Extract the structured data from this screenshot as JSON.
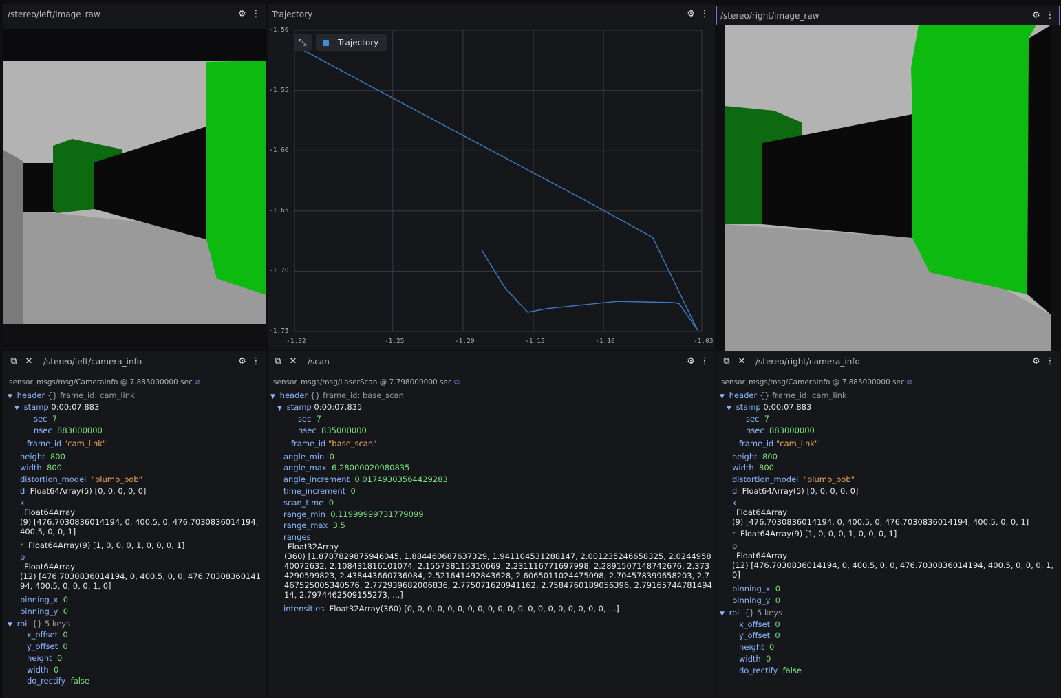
{
  "panels": {
    "left_image": {
      "title": "/stereo/left/image_raw"
    },
    "trajectory": {
      "title": "Trajectory",
      "legend": "Trajectory"
    },
    "right_image": {
      "title": "/stereo/right/image_raw"
    },
    "left_info": {
      "title": "/stereo/left/camera_info",
      "meta": "sensor_msgs/msg/CameraInfo @ 7.885000000 sec"
    },
    "scan": {
      "title": "/scan",
      "meta": "sensor_msgs/msg/LaserScan @ 7.798000000 sec"
    },
    "right_info": {
      "title": "/stereo/right/camera_info",
      "meta": "sensor_msgs/msg/CameraInfo @ 7.885000000 sec"
    }
  },
  "camera_info": {
    "header": "header",
    "header_sum": "{} frame_id: cam_link",
    "stamp": "stamp",
    "stamp_val": "0:00:07.883",
    "sec": "sec",
    "sec_val": "7",
    "nsec": "nsec",
    "nsec_val": "883000000",
    "frame_id": "frame_id",
    "frame_id_val": "\"cam_link\"",
    "height": "height",
    "height_val": "800",
    "width": "width",
    "width_val": "800",
    "distortion_model": "distortion_model",
    "distortion_model_val": "\"plumb_bob\"",
    "d": "d",
    "d_val": "Float64Array(5) [0, 0, 0, 0, 0]",
    "k": "k",
    "k_type": "Float64Array",
    "k_val": "(9) [476.7030836014194, 0, 400.5, 0, 476.7030836014194, 400.5, 0, 0, 1]",
    "r": "r",
    "r_val": "Float64Array(9) [1, 0, 0, 0, 1, 0, 0, 0, 1]",
    "p": "p",
    "p_type": "Float64Array",
    "p_val": "(12) [476.7030836014194, 0, 400.5, 0, 0, 476.7030836014194, 400.5, 0, 0, 0, 1, 0]",
    "binning_x": "binning_x",
    "binning_x_val": "0",
    "binning_y": "binning_y",
    "binning_y_val": "0",
    "roi": "roi",
    "roi_sum": "{} 5 keys",
    "x_offset": "x_offset",
    "x_offset_val": "0",
    "y_offset": "y_offset",
    "y_offset_val": "0",
    "roi_height": "height",
    "roi_height_val": "0",
    "roi_width": "width",
    "roi_width_val": "0",
    "do_rectify": "do_rectify",
    "do_rectify_val": "false"
  },
  "scan": {
    "header": "header",
    "header_sum": "{} frame_id: base_scan",
    "stamp": "stamp",
    "stamp_val": "0:00:07.835",
    "sec": "sec",
    "sec_val": "7",
    "nsec": "nsec",
    "nsec_val": "835000000",
    "frame_id": "frame_id",
    "frame_id_val": "\"base_scan\"",
    "angle_min": "angle_min",
    "angle_min_val": "0",
    "angle_max": "angle_max",
    "angle_max_val": "6.28000020980835",
    "angle_increment": "angle_increment",
    "angle_increment_val": "0.017493035644292​83",
    "time_increment": "time_increment",
    "time_increment_val": "0",
    "scan_time": "scan_time",
    "scan_time_val": "0",
    "range_min": "range_min",
    "range_min_val": "0.11999999731779099",
    "range_max": "range_max",
    "range_max_val": "3.5",
    "ranges": "ranges",
    "ranges_type": "Float32Array",
    "ranges_val": "(360) [1.8787829875946045, 1.884460687637329, 1.941104531288147, 2.001235246658325, 2.024495840072632, 2.108431816101074, 2.155738115310669, 2.231116771697998, 2.2891507148742676, 2.3734290599823, 2.438443660736084, 2.521641492843628, 2.6065011024475098, 2.704578399658203, 2.7467525005340576, 2.772939682006836, 2.775071620941162, 2.7584760189056396, 2.7916574478149414, 2.7974462509155273, ...]",
    "intensities": "intensities",
    "intensities_val": "Float32Array(360) [0, 0, 0, 0, 0, 0, 0, 0, 0, 0, 0, 0, 0, 0, 0, 0, 0, 0, 0, 0, ...]"
  },
  "chart_data": {
    "type": "line",
    "title": "Trajectory",
    "xlim": [
      -1.32,
      -1.03
    ],
    "ylim": [
      -1.75,
      -1.5
    ],
    "x_ticks": [
      "-1.32",
      "-1.25",
      "-1.20",
      "-1.15",
      "-1.10",
      "-1.03"
    ],
    "y_ticks": [
      "-1.50",
      "-1.55",
      "-1.60",
      "-1.65",
      "-1.70",
      "-1.75"
    ],
    "grid": true,
    "legend": "top-left",
    "series": [
      {
        "name": "Trajectory",
        "color": "#3b7dc4",
        "x": [
          -1.313,
          -1.265,
          -1.215,
          -1.165,
          -1.115,
          -1.065,
          -1.033,
          -1.046,
          -1.05,
          -1.09,
          -1.14,
          -1.154,
          -1.17,
          -1.187
        ],
        "y": [
          -1.517,
          -1.547,
          -1.578,
          -1.609,
          -1.64,
          -1.672,
          -1.749,
          -1.727,
          -1.726,
          -1.725,
          -1.731,
          -1.734,
          -1.714,
          -1.682
        ]
      }
    ]
  },
  "colors": {
    "accent": "#7b6fd4",
    "key": "#8ab8ff",
    "number": "#7be27b",
    "string": "#f0a85b"
  },
  "icons": [
    "gear-icon",
    "kebab-menu-icon",
    "copy-icon",
    "collapse-icon",
    "minimize-icon"
  ]
}
